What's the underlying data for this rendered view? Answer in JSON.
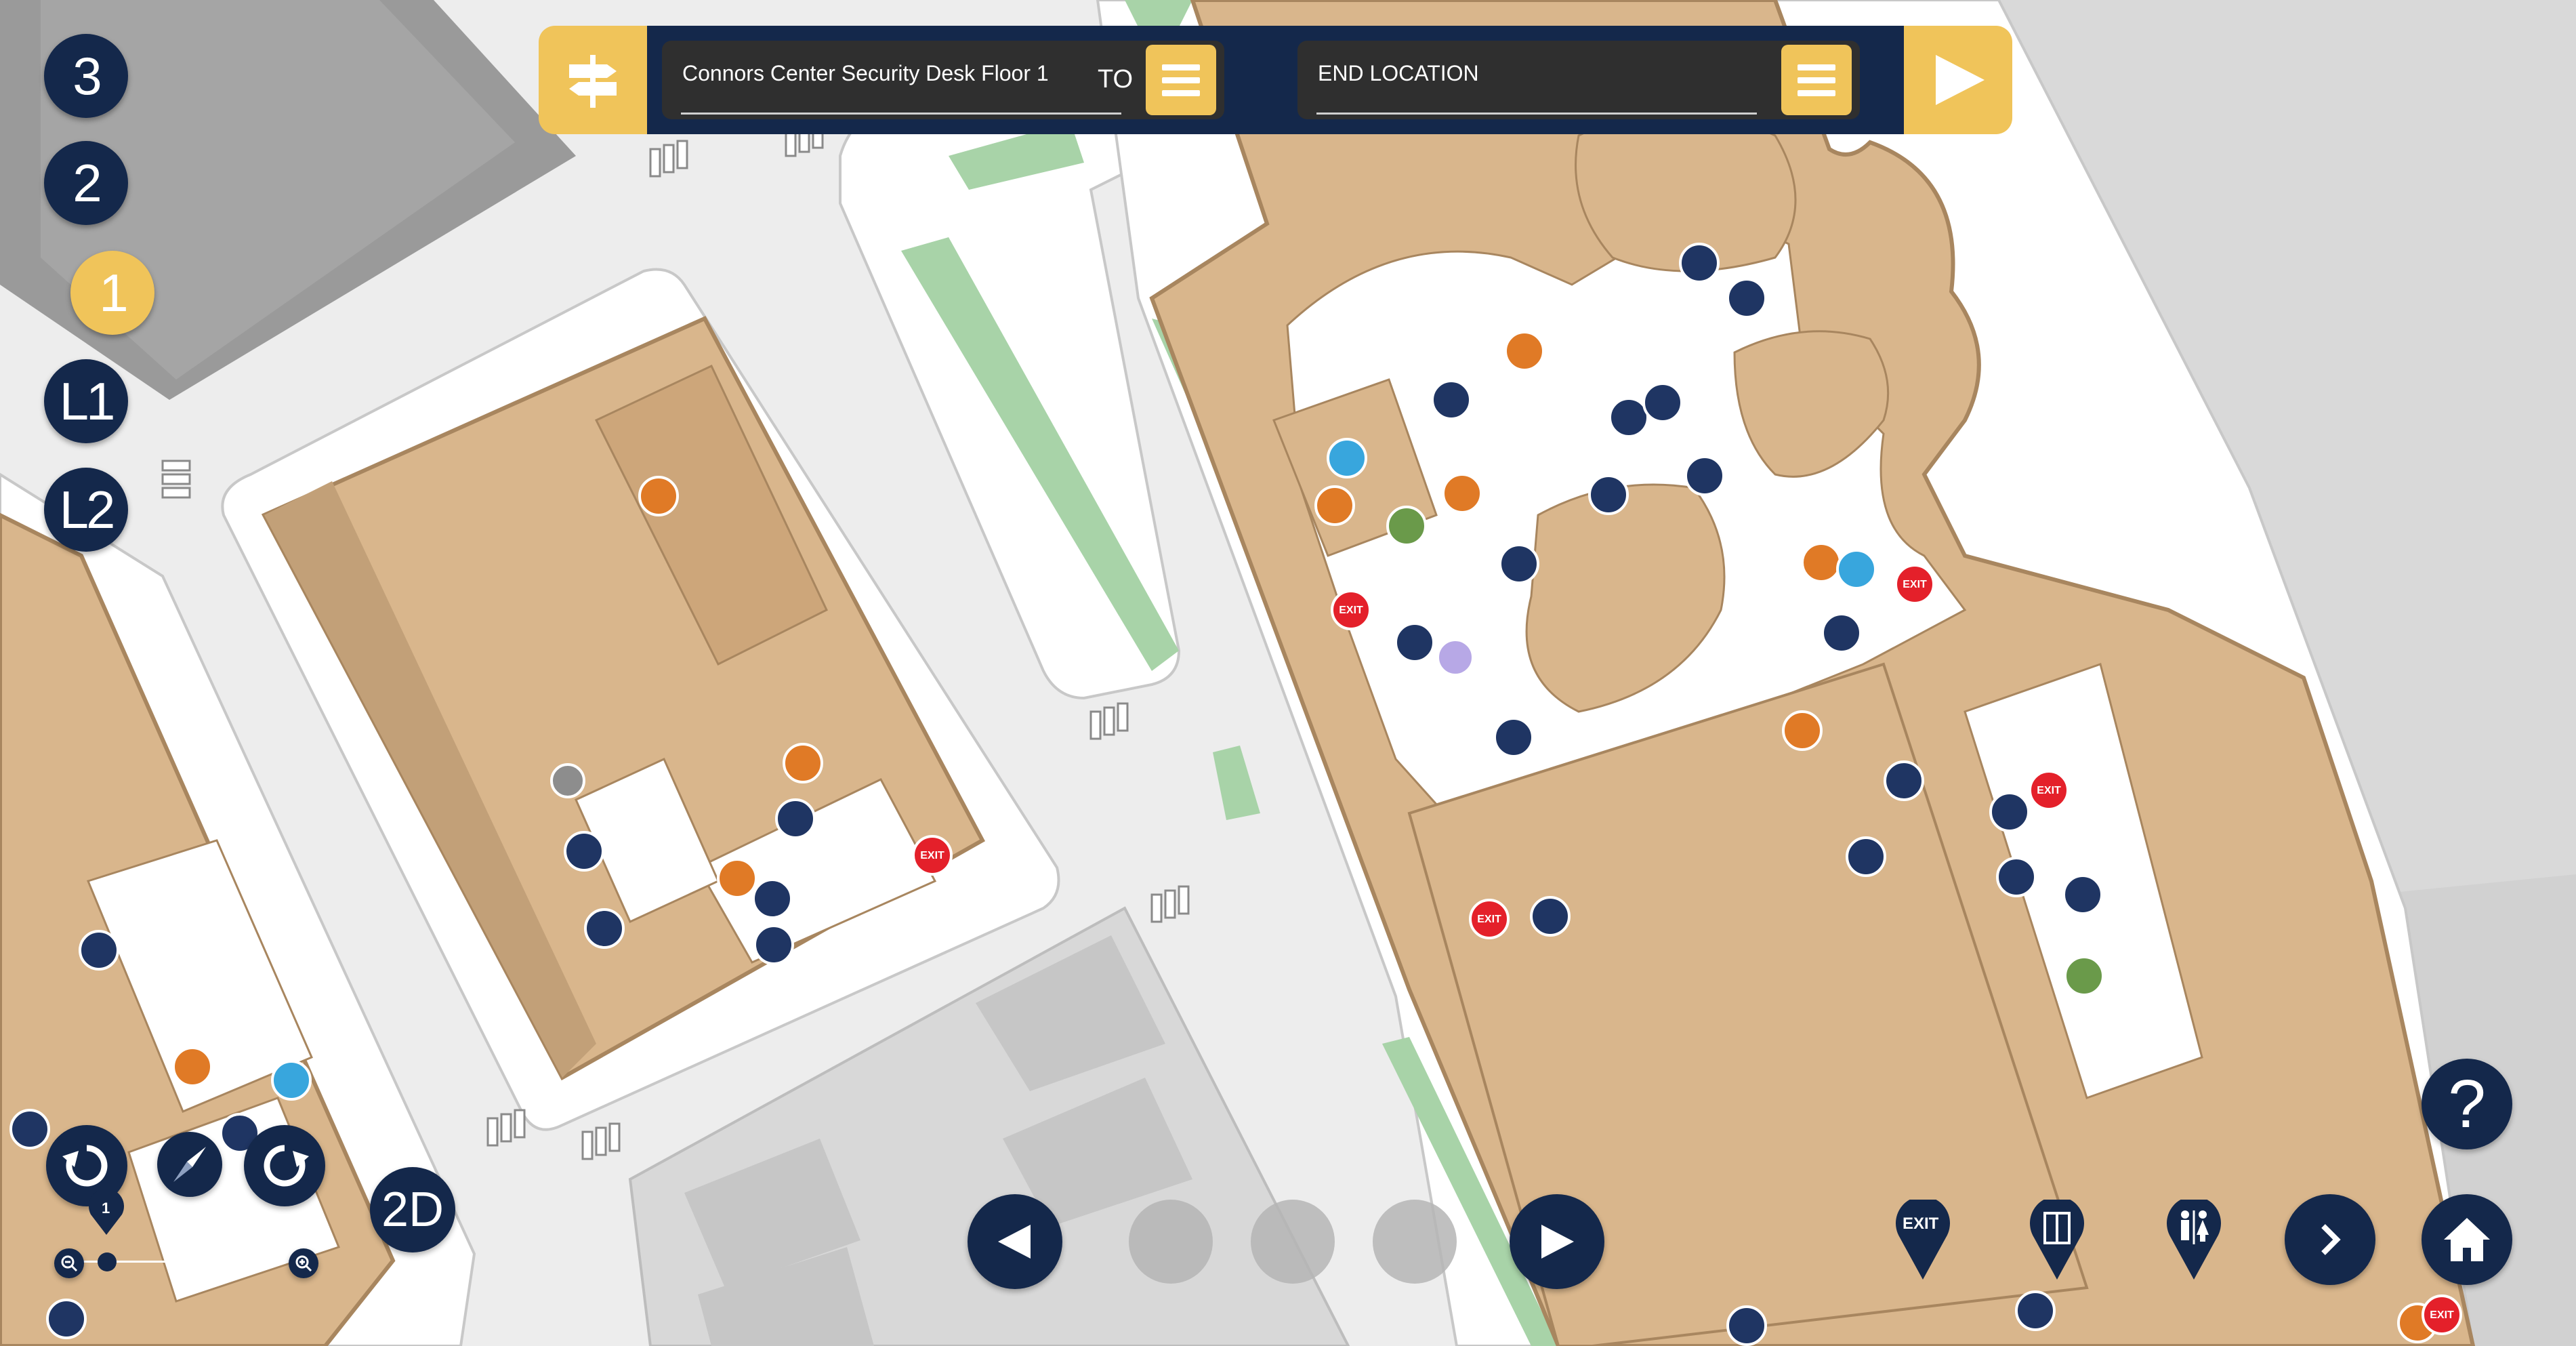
{
  "floors": [
    "3",
    "2",
    "1",
    "L1",
    "L2"
  ],
  "active_floor": "1",
  "route": {
    "start_value": "Connors Center Security Desk Floor 1",
    "to_label": "TO",
    "end_value": "END LOCATION"
  },
  "view_mode_label": "2D",
  "zoom_level": "1",
  "help_label": "?",
  "legend": {
    "exit_label": "EXIT",
    "items": [
      "exit-pin",
      "elevator-pin",
      "restroom-pin"
    ]
  },
  "map_labels": {
    "exit_badge": "EXIT"
  },
  "colors": {
    "navy": "#14284b",
    "accent_yellow": "#f0c45a",
    "building_tan": "#d9b68c",
    "street_grey": "#e9e9e9",
    "green_space": "#a8d3a8",
    "restroom_orange": "#e07a26",
    "exit_red": "#e4202a",
    "info_green": "#6a9a4a",
    "tag_blue": "#38a6dd"
  },
  "icons": [
    "directions-sign-icon",
    "menu-icon",
    "play-icon",
    "rotate-left-icon",
    "compass-icon",
    "rotate-right-icon",
    "zoom-out-icon",
    "zoom-in-icon",
    "previous-arrow-icon",
    "next-arrow-icon",
    "chevron-right-icon",
    "home-icon",
    "help-icon"
  ]
}
